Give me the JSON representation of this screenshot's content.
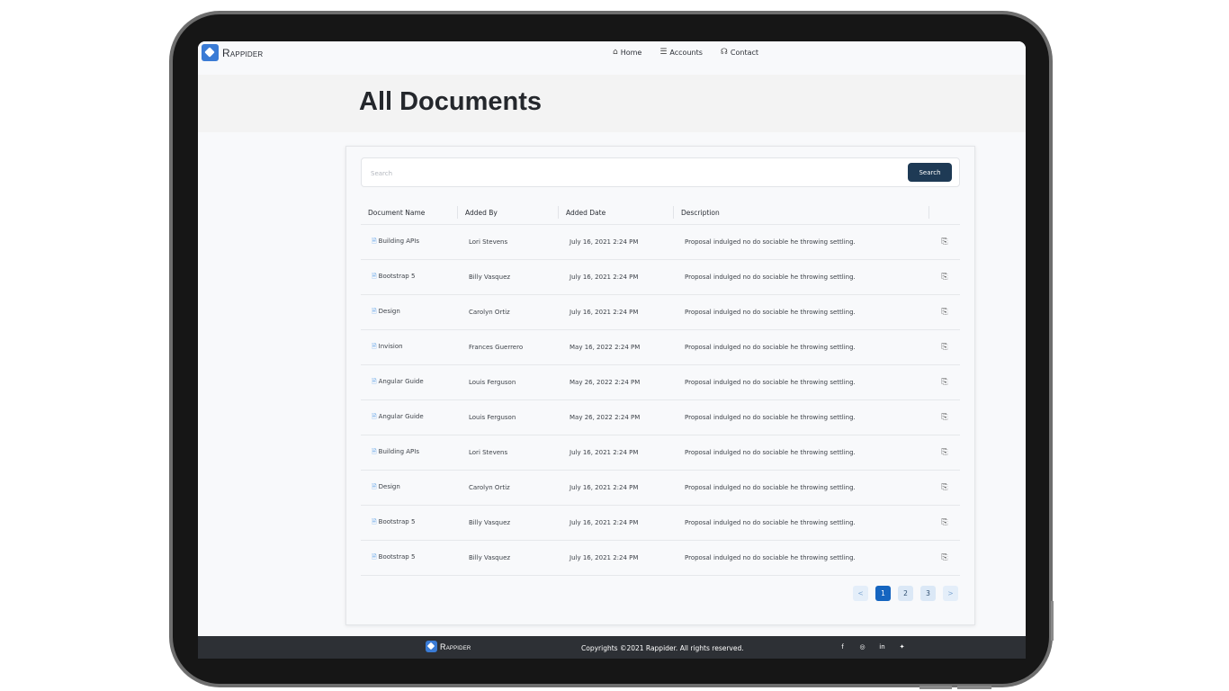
{
  "brand": {
    "name": "Rappider"
  },
  "nav": [
    {
      "icon": "home-icon",
      "glyph": "⌂",
      "label": "Home"
    },
    {
      "icon": "accounts-icon",
      "glyph": "☰",
      "label": "Accounts"
    },
    {
      "icon": "headset-icon",
      "glyph": "☊",
      "label": "Contact"
    }
  ],
  "page": {
    "title": "All Documents"
  },
  "search": {
    "placeholder": "Search",
    "value": "",
    "button_label": "Search"
  },
  "table": {
    "headers": [
      "Document Name",
      "Added By",
      "Added Date",
      "Description"
    ],
    "rows": [
      {
        "name": "Building APIs",
        "added_by": "Lori Stevens",
        "date": "July 16, 2021 2:24 PM",
        "description": "Proposal indulged no do sociable he throwing settling."
      },
      {
        "name": "Bootstrap 5",
        "added_by": "Billy Vasquez",
        "date": "July 16, 2021 2:24 PM",
        "description": "Proposal indulged no do sociable he throwing settling."
      },
      {
        "name": "Design",
        "added_by": "Carolyn Ortiz",
        "date": "July 16, 2021 2:24 PM",
        "description": "Proposal indulged no do sociable he throwing settling."
      },
      {
        "name": "Invision",
        "added_by": "Frances Guerrero",
        "date": "May 16, 2022 2:24 PM",
        "description": "Proposal indulged no do sociable he throwing settling."
      },
      {
        "name": "Angular Guide",
        "added_by": "Louis Ferguson",
        "date": "May 26, 2022 2:24 PM",
        "description": "Proposal indulged no do sociable he throwing settling."
      },
      {
        "name": "Angular Guide",
        "added_by": "Louis Ferguson",
        "date": "May 26, 2022 2:24 PM",
        "description": "Proposal indulged no do sociable he throwing settling."
      },
      {
        "name": "Building APIs",
        "added_by": "Lori Stevens",
        "date": "July 16, 2021 2:24 PM",
        "description": "Proposal indulged no do sociable he throwing settling."
      },
      {
        "name": "Design",
        "added_by": "Carolyn Ortiz",
        "date": "July 16, 2021 2:24 PM",
        "description": "Proposal indulged no do sociable he throwing settling."
      },
      {
        "name": "Bootstrap 5",
        "added_by": "Billy Vasquez",
        "date": "July 16, 2021 2:24 PM",
        "description": "Proposal indulged no do sociable he throwing settling."
      },
      {
        "name": "Bootstrap 5",
        "added_by": "Billy Vasquez",
        "date": "July 16, 2021 2:24 PM",
        "description": "Proposal indulged no do sociable he throwing settling."
      }
    ]
  },
  "pagination": {
    "prev": "<",
    "pages": [
      "1",
      "2",
      "3"
    ],
    "active": "1",
    "next": ">"
  },
  "footer": {
    "copyright": "Copyrights ©2021 Rappider. All rights reserved.",
    "socials": [
      {
        "icon": "facebook-icon",
        "glyph": "f"
      },
      {
        "icon": "instagram-icon",
        "glyph": "◎"
      },
      {
        "icon": "linkedin-icon",
        "glyph": "in"
      },
      {
        "icon": "twitter-icon",
        "glyph": "✦"
      }
    ]
  },
  "colors": {
    "accent": "#1565c0",
    "search_button": "#1e3a55",
    "footer": "#2d3035",
    "logo": "#3a7bd5"
  }
}
